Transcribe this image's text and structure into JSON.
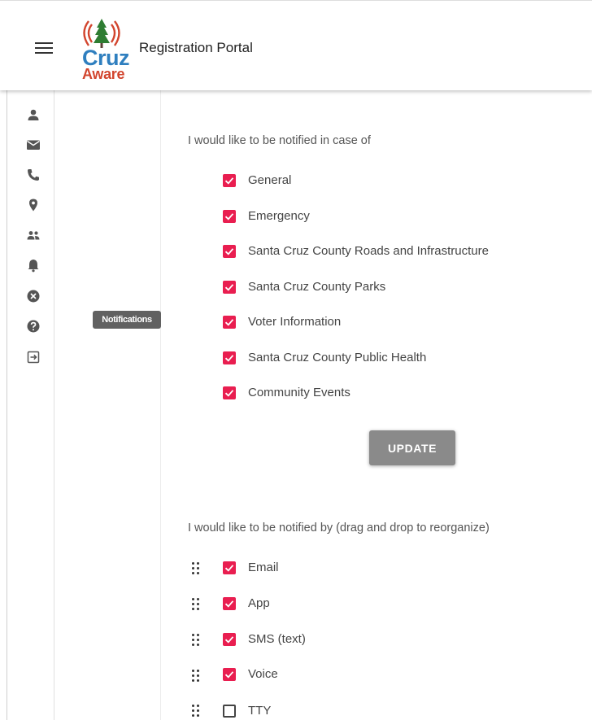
{
  "header": {
    "menu_icon": "hamburger-menu-icon",
    "logo_line1": "Cruz",
    "logo_line2": "Aware",
    "title": "Registration Portal"
  },
  "sidebar": {
    "items": [
      {
        "icon": "person-icon"
      },
      {
        "icon": "envelope-icon"
      },
      {
        "icon": "phone-icon"
      },
      {
        "icon": "location-pin-icon"
      },
      {
        "icon": "group-icon"
      },
      {
        "icon": "bell-icon",
        "active": true
      },
      {
        "icon": "cancel-circle-icon"
      },
      {
        "icon": "help-circle-icon"
      },
      {
        "icon": "logout-icon"
      }
    ],
    "tooltip": "Notifications"
  },
  "topics": {
    "heading": "I would like to be notified in case of",
    "items": [
      {
        "label": "General",
        "checked": true
      },
      {
        "label": "Emergency",
        "checked": true
      },
      {
        "label": "Santa Cruz County Roads and Infrastructure",
        "checked": true
      },
      {
        "label": "Santa Cruz County Parks",
        "checked": true
      },
      {
        "label": "Voter Information",
        "checked": true
      },
      {
        "label": "Santa Cruz County Public Health",
        "checked": true
      },
      {
        "label": "Community Events",
        "checked": true
      }
    ],
    "update_label": "UPDATE"
  },
  "channels": {
    "heading": "I would like to be notified by (drag and drop to reorganize)",
    "items": [
      {
        "label": "Email",
        "checked": true
      },
      {
        "label": "App",
        "checked": true
      },
      {
        "label": "SMS (text)",
        "checked": true
      },
      {
        "label": "Voice",
        "checked": true
      },
      {
        "label": "TTY",
        "checked": false
      }
    ]
  },
  "colors": {
    "accent": "#e91e50",
    "button": "#8a8a8a",
    "tooltip": "#616161",
    "logo_blue": "#2f7fbf",
    "logo_red": "#d2452e"
  }
}
